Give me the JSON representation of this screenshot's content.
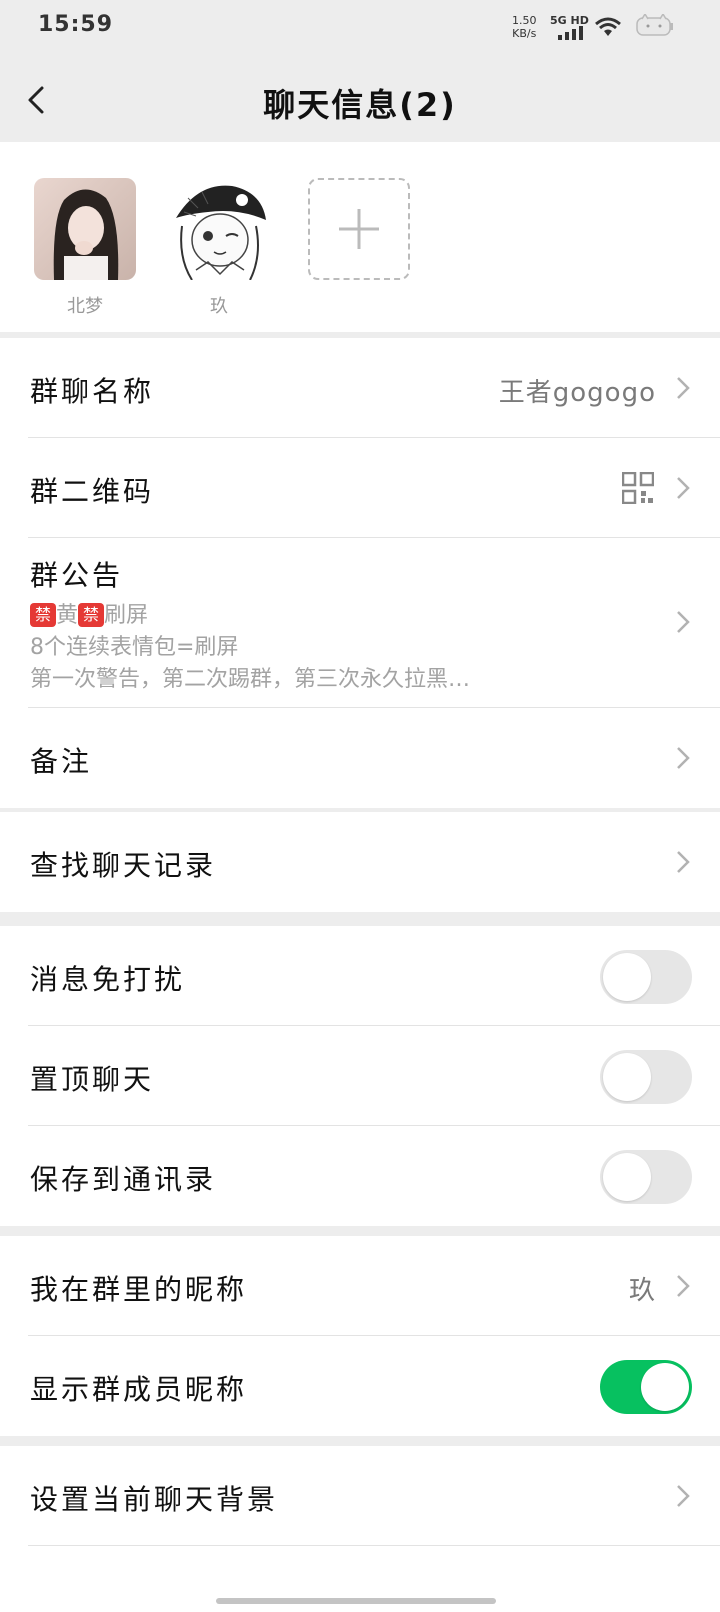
{
  "status_bar": {
    "time": "15:59",
    "net_speed_value": "1.50",
    "net_speed_unit": "KB/s",
    "network_label": "5G HD"
  },
  "nav": {
    "title": "聊天信息(2)"
  },
  "members": [
    {
      "name": "北梦"
    },
    {
      "name": "玖"
    }
  ],
  "info_group": {
    "group_name_label": "群聊名称",
    "group_name_value": "王者gogogo",
    "qrcode_label": "群二维码",
    "notice_label": "群公告",
    "notice_line1_a": "黄",
    "notice_line1_b": "刷屏",
    "notice_ban_glyph": "禁",
    "notice_line2": "8个连续表情包=刷屏",
    "notice_line3": "第一次警告，第二次踢群，第三次永久拉黑…",
    "remark_label": "备注"
  },
  "search": {
    "label": "查找聊天记录"
  },
  "toggles": {
    "mute_label": "消息免打扰",
    "mute_on": false,
    "pin_label": "置顶聊天",
    "pin_on": false,
    "save_label": "保存到通讯录",
    "save_on": false
  },
  "nickname": {
    "my_nickname_label": "我在群里的昵称",
    "my_nickname_value": "玖",
    "show_nicknames_label": "显示群成员昵称",
    "show_nicknames_on": true
  },
  "background": {
    "label": "设置当前聊天背景"
  },
  "colors": {
    "toggle_on": "#07c160",
    "ban_badge": "#e53935"
  }
}
